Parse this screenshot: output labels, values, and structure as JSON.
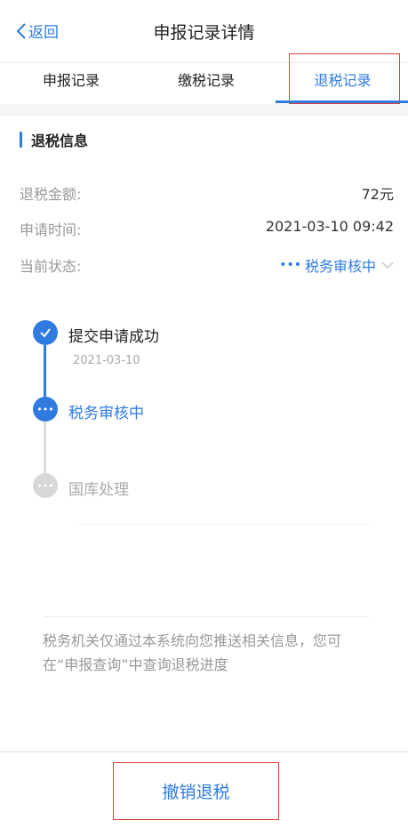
{
  "nav": {
    "back_label": "返回",
    "title": "申报记录详情"
  },
  "tabs": [
    {
      "label": "申报记录"
    },
    {
      "label": "缴税记录"
    },
    {
      "label": "退税记录"
    }
  ],
  "section": {
    "title": "退税信息"
  },
  "details": {
    "amount_label": "退税金额:",
    "amount_value": "72元",
    "time_label": "申请时间:",
    "time_value": "2021-03-10 09:42",
    "status_label": "当前状态:",
    "status_value": "税务审核中"
  },
  "timeline": [
    {
      "title": "提交申请成功",
      "date": "2021-03-10",
      "state": "done"
    },
    {
      "title": "税务审核中",
      "state": "active"
    },
    {
      "title": "国库处理",
      "state": "pending"
    }
  ],
  "notice": "税务机关仅通过本系统向您推送相关信息，您可在“申报查询”中查询退税进度",
  "footer": {
    "cancel_label": "撤销退税"
  },
  "colors": {
    "accent": "#2f7be0",
    "highlight_border": "#e0403a"
  }
}
